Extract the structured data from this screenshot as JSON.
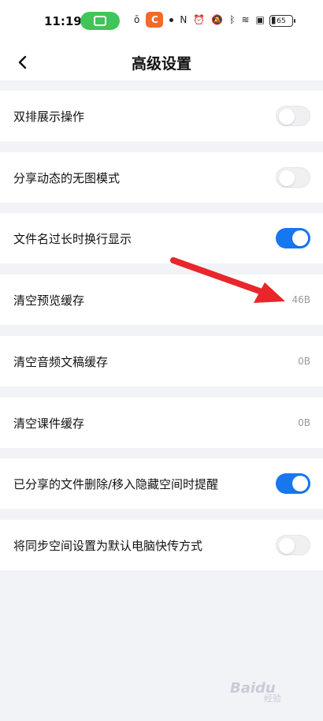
{
  "status": {
    "time": "11:19",
    "battery": "65"
  },
  "header": {
    "title": "高级设置"
  },
  "rows": [
    {
      "label": "双排展示操作",
      "type": "toggle",
      "on": false
    },
    {
      "label": "分享动态的无图模式",
      "type": "toggle",
      "on": false
    },
    {
      "label": "文件名过长时换行显示",
      "type": "toggle",
      "on": true
    },
    {
      "label": "清空预览缓存",
      "type": "value",
      "value": "46B"
    },
    {
      "label": "清空音频文稿缓存",
      "type": "value",
      "value": "0B"
    },
    {
      "label": "清空课件缓存",
      "type": "value",
      "value": "0B"
    },
    {
      "label": "已分享的文件删除/移入隐藏空间时提醒",
      "type": "toggle",
      "on": true
    },
    {
      "label": "将同步空间设置为默认电脑快传方式",
      "type": "toggle",
      "on": false
    }
  ],
  "colors": {
    "accent": "#1677ef",
    "annotation": "#e8262c",
    "background": "#f2f3f7"
  },
  "watermark": {
    "text": "Baidu",
    "sub": "经验"
  }
}
